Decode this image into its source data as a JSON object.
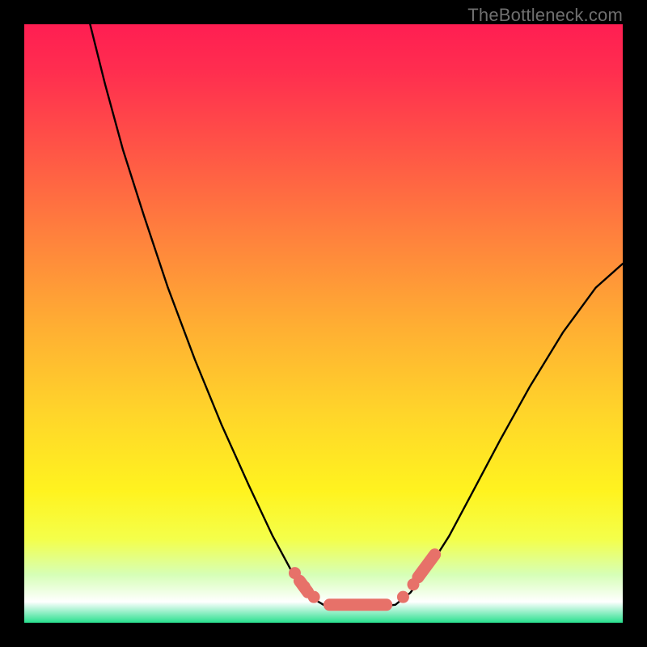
{
  "watermark": "TheBottleneck.com",
  "colors": {
    "frame": "#000000",
    "gradient_stops": [
      {
        "offset": 0.0,
        "color": "#ff1e52"
      },
      {
        "offset": 0.08,
        "color": "#ff2e4f"
      },
      {
        "offset": 0.2,
        "color": "#ff5247"
      },
      {
        "offset": 0.35,
        "color": "#ff803d"
      },
      {
        "offset": 0.5,
        "color": "#ffad33"
      },
      {
        "offset": 0.65,
        "color": "#ffd52a"
      },
      {
        "offset": 0.78,
        "color": "#fff31f"
      },
      {
        "offset": 0.86,
        "color": "#f4ff4a"
      },
      {
        "offset": 0.92,
        "color": "#d6ffb7"
      },
      {
        "offset": 0.965,
        "color": "#ffffff"
      },
      {
        "offset": 1.0,
        "color": "#28e08e"
      }
    ],
    "curve_stroke": "#000000",
    "marker_fill": "#e77169",
    "marker_pill_fill": "#e77169"
  },
  "chart_data": {
    "type": "line",
    "title": "",
    "xlabel": "",
    "ylabel": "",
    "xlim": [
      0,
      100
    ],
    "ylim": [
      0,
      100
    ],
    "notes": "Bottleneck-style V curve on a vertical red→green gradient. No axis ticks or labels are rendered in the image; all values are visual estimates in percent of plot width/height.",
    "series": [
      {
        "name": "left-branch",
        "x": [
          11.0,
          13.5,
          16.5,
          20.0,
          24.0,
          28.5,
          33.0,
          37.5,
          41.5,
          45.0,
          47.5,
          50.0
        ],
        "y": [
          100.0,
          90.0,
          79.0,
          68.0,
          56.0,
          44.0,
          33.0,
          23.0,
          14.5,
          8.0,
          4.5,
          3.0
        ]
      },
      {
        "name": "flat-valley",
        "x": [
          50.0,
          52.0,
          54.0,
          56.0,
          58.0,
          60.0,
          62.0
        ],
        "y": [
          3.0,
          2.8,
          2.8,
          2.8,
          2.8,
          2.8,
          3.0
        ]
      },
      {
        "name": "right-branch",
        "x": [
          62.0,
          64.5,
          67.5,
          71.0,
          75.0,
          79.5,
          84.5,
          90.0,
          95.5,
          100.0
        ],
        "y": [
          3.0,
          5.0,
          9.0,
          14.5,
          22.0,
          30.5,
          39.5,
          48.5,
          56.0,
          60.0
        ]
      }
    ],
    "markers": {
      "dots": [
        {
          "x": 45.2,
          "y": 8.3
        },
        {
          "x": 46.8,
          "y": 6.0
        },
        {
          "x": 48.4,
          "y": 4.3
        },
        {
          "x": 63.3,
          "y": 4.3
        },
        {
          "x": 65.0,
          "y": 6.4
        }
      ],
      "pills": [
        {
          "x1": 51.0,
          "y1": 3.0,
          "x2": 60.5,
          "y2": 3.0
        },
        {
          "x1": 65.8,
          "y1": 7.6,
          "x2": 68.6,
          "y2": 11.4
        },
        {
          "x1": 46.0,
          "y1": 7.0,
          "x2": 47.4,
          "y2": 5.1
        }
      ]
    }
  }
}
